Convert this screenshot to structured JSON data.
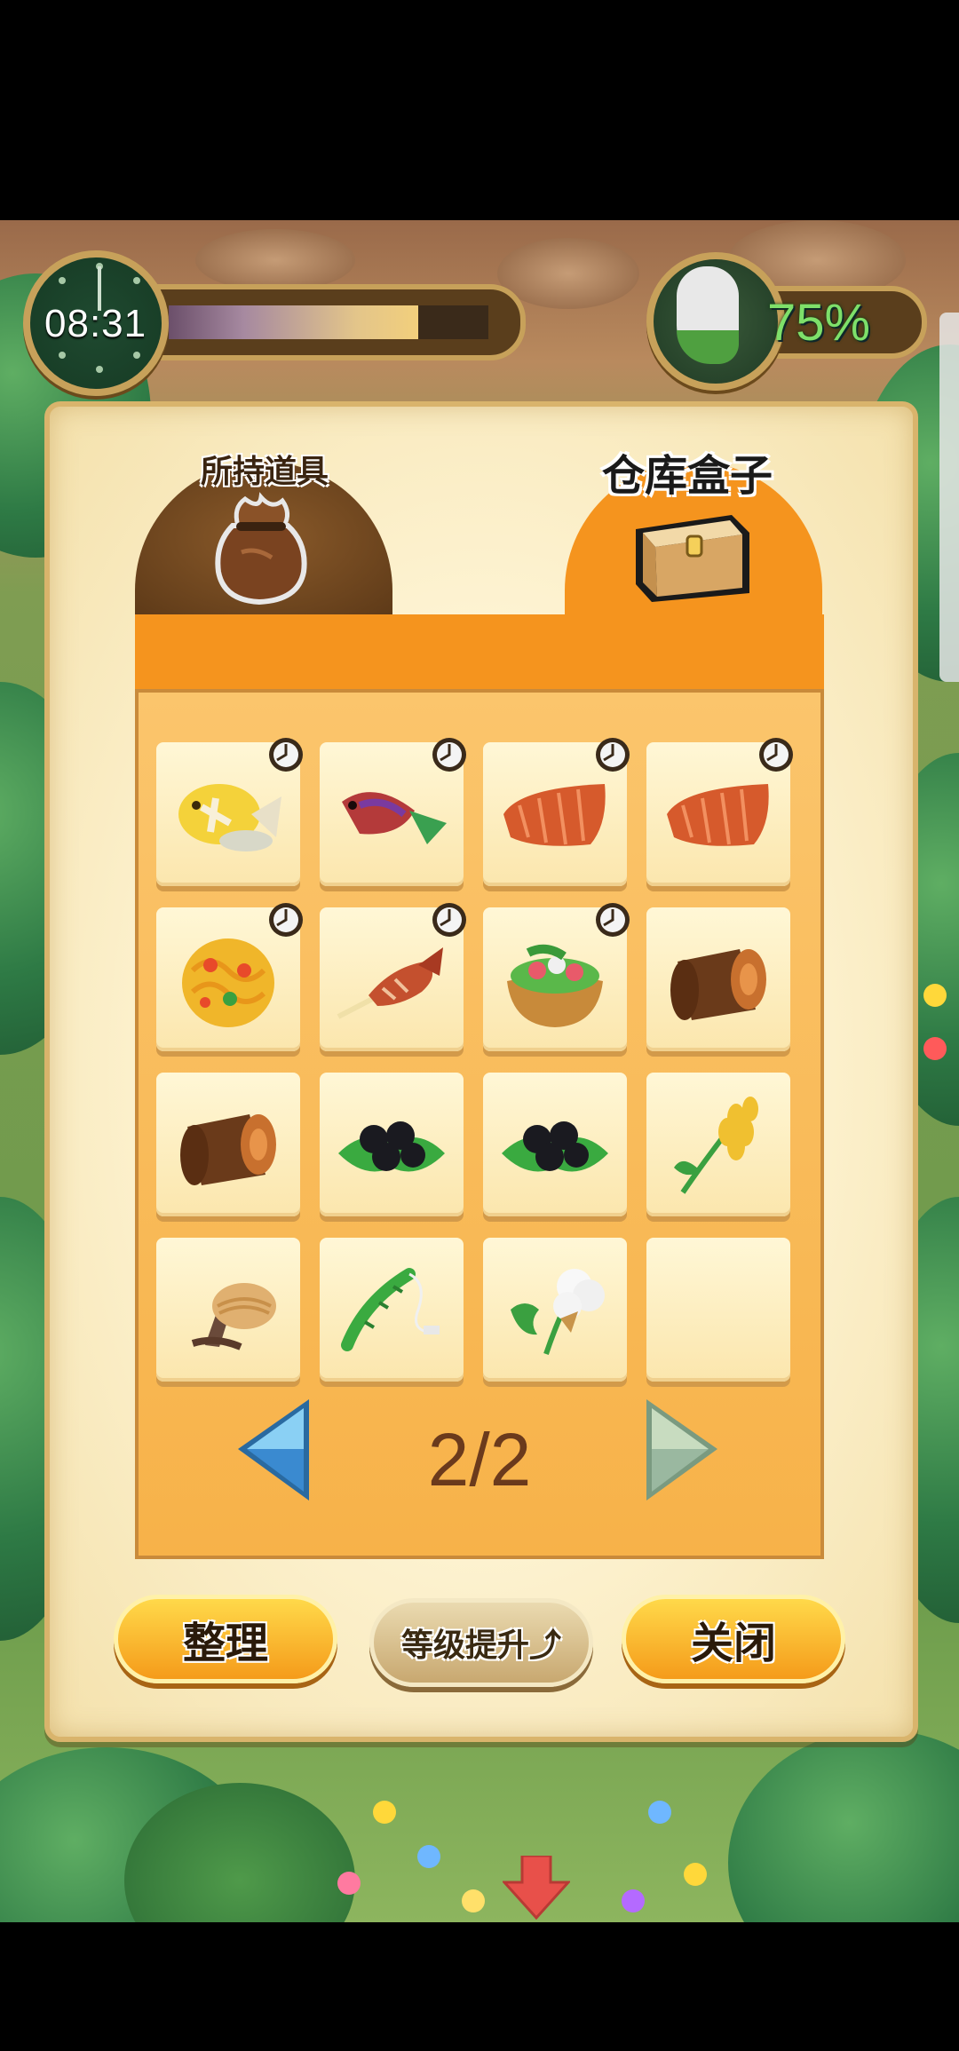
{
  "hud": {
    "time": "08:31",
    "time_progress": 0.78,
    "stomach_percent": "75%"
  },
  "tabs": {
    "owned_items": "所持道具",
    "storage_box": "仓库盒子",
    "active": "storage_box"
  },
  "inventory": {
    "page": "2/2",
    "slots": [
      {
        "item": "yellow-grilled-fish",
        "timer": true
      },
      {
        "item": "red-grilled-fish",
        "timer": true
      },
      {
        "item": "salmon-fillet",
        "timer": true
      },
      {
        "item": "salmon-fillet",
        "timer": true
      },
      {
        "item": "fried-noodles",
        "timer": true
      },
      {
        "item": "fish-skewer",
        "timer": true
      },
      {
        "item": "seafood-salad-bowl",
        "timer": true
      },
      {
        "item": "wood-log",
        "timer": false
      },
      {
        "item": "wood-log",
        "timer": false
      },
      {
        "item": "black-berries",
        "timer": false
      },
      {
        "item": "black-berries",
        "timer": false
      },
      {
        "item": "wheat",
        "timer": false
      },
      {
        "item": "mushroom",
        "timer": false
      },
      {
        "item": "bamboo-whip",
        "timer": false
      },
      {
        "item": "cotton-plant",
        "timer": false
      },
      {
        "item": "",
        "timer": false
      }
    ]
  },
  "buttons": {
    "sort": "整理",
    "upgrade": "等级提升⤴",
    "close": "关闭"
  },
  "colors": {
    "tab_active": "#f5941e",
    "tab_inactive": "#6e4520",
    "panel": "#fff6d8",
    "button": "#f9b52a"
  }
}
